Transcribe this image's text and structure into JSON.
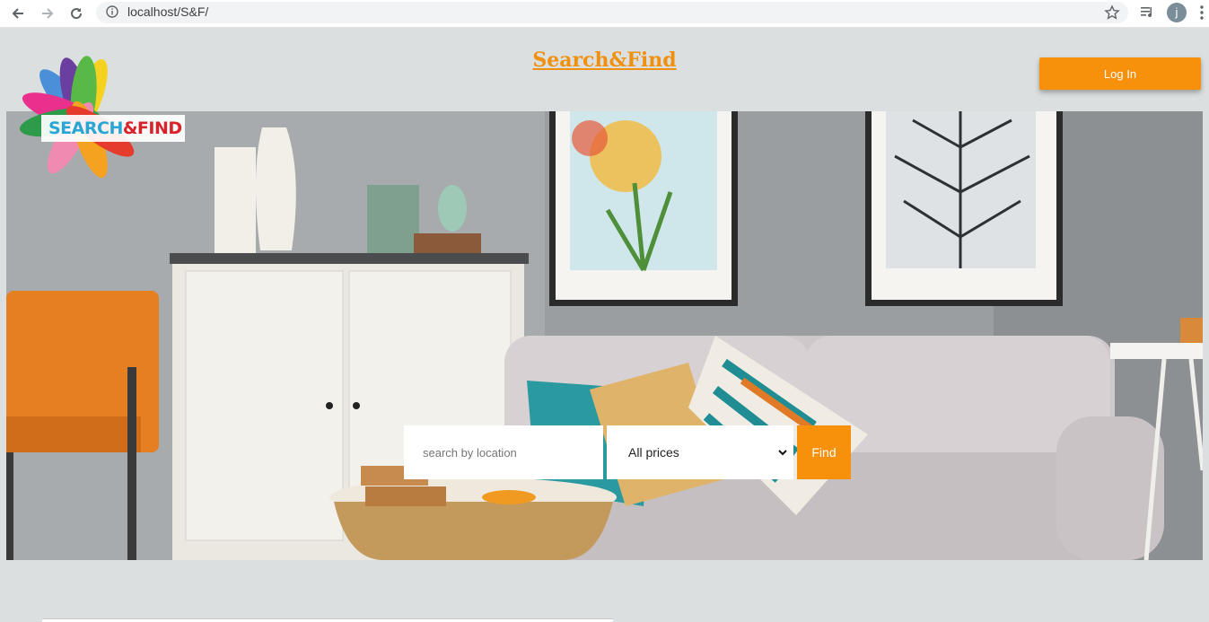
{
  "browser": {
    "url": "localhost/S&F/",
    "avatar_letter": "j"
  },
  "header": {
    "site_title": "Search&Find",
    "login_label": "Log In"
  },
  "logo": {
    "text_part1": "SEARCH",
    "text_part2": "&FIND"
  },
  "search": {
    "location_placeholder": "search by location",
    "location_value": "",
    "price_selected": "All prices",
    "find_label": "Find"
  },
  "colors": {
    "accent": "#f7900a",
    "title": "#f0900f",
    "page_bg": "#dcdfdf"
  }
}
